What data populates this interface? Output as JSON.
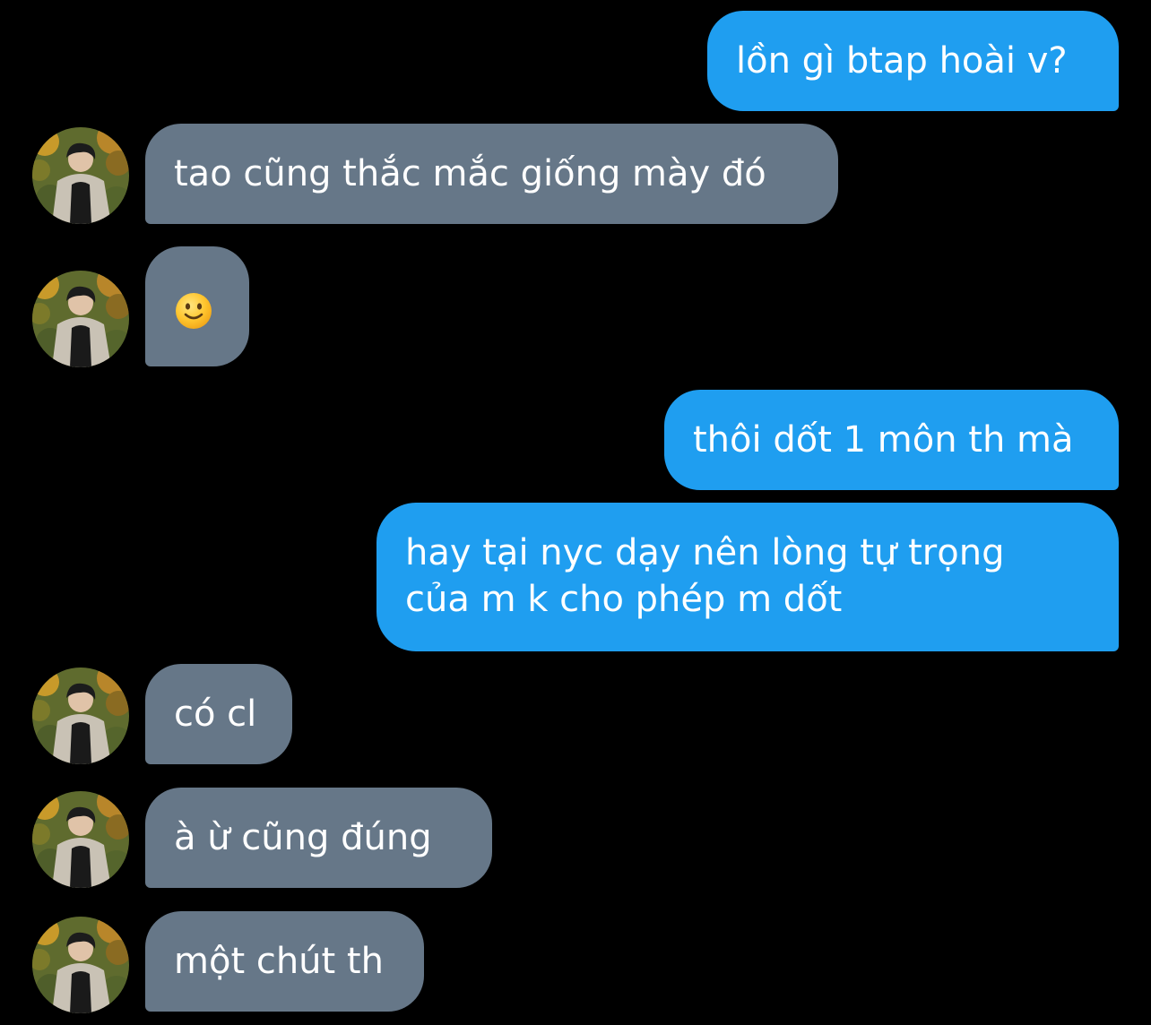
{
  "messages": [
    {
      "id": "m1",
      "direction": "outgoing",
      "text": "lồn gì btap hoài v?"
    },
    {
      "id": "m2",
      "direction": "incoming",
      "text": "tao cũng thắc mắc giống mày đó"
    },
    {
      "id": "m3",
      "direction": "incoming",
      "text": "🙂",
      "type": "emoji",
      "emoji_name": "slightly-smiling-face-icon"
    },
    {
      "id": "m4",
      "direction": "outgoing",
      "text": "thôi dốt 1 môn th mà"
    },
    {
      "id": "m5",
      "direction": "outgoing",
      "lines": [
        "hay tại nyc dạy nên lòng tự trọng",
        "của m k cho phép m dốt"
      ]
    },
    {
      "id": "m6",
      "direction": "incoming",
      "text": "có cl"
    },
    {
      "id": "m7",
      "direction": "incoming",
      "text": "à ừ cũng đúng"
    },
    {
      "id": "m8",
      "direction": "incoming",
      "text": "một chút th"
    }
  ],
  "colors": {
    "background": "#000000",
    "outgoing_bubble": "#1f9ef0",
    "incoming_bubble": "#667788",
    "text": "#ffffff"
  },
  "icons": {
    "avatar": "contact-avatar-icon"
  }
}
